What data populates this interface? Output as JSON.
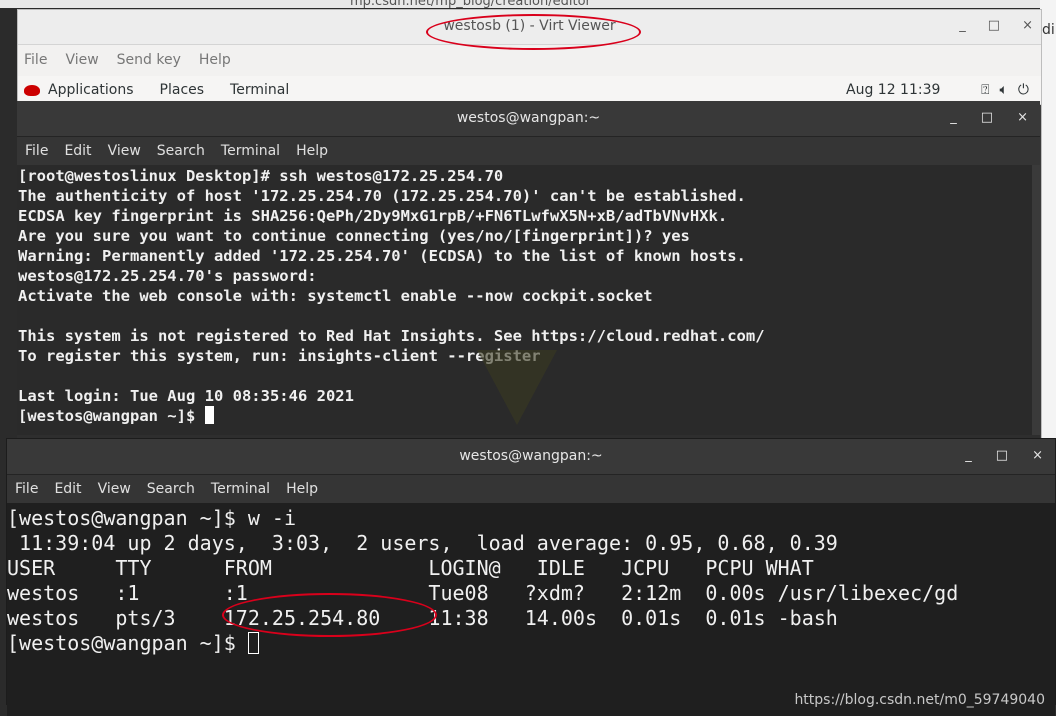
{
  "browser": {
    "url_fragment": "mp.csdn.net/mp_blog/creation/editor",
    "right_edge_text": "din"
  },
  "virt_viewer": {
    "title": "westosb (1) - Virt Viewer",
    "controls": [
      "_",
      "□",
      "×"
    ],
    "menu": [
      "File",
      "View",
      "Send key",
      "Help"
    ]
  },
  "gnome": {
    "applications": "Applications",
    "places": "Places",
    "terminal": "Terminal",
    "clock": "Aug 12  11:39",
    "icons": [
      "network-icon",
      "volume-icon",
      "power-icon"
    ]
  },
  "terminal1": {
    "title": "westos@wangpan:~",
    "controls": [
      "_",
      "□",
      "×"
    ],
    "menu": [
      "File",
      "Edit",
      "View",
      "Search",
      "Terminal",
      "Help"
    ],
    "lines": [
      "[root@westoslinux Desktop]# ssh westos@172.25.254.70",
      "The authenticity of host '172.25.254.70 (172.25.254.70)' can't be established.",
      "ECDSA key fingerprint is SHA256:QePh/2Dy9MxG1rpB/+FN6TLwfwX5N+xB/adTbVNvHXk.",
      "Are you sure you want to continue connecting (yes/no/[fingerprint])? yes",
      "Warning: Permanently added '172.25.254.70' (ECDSA) to the list of known hosts.",
      "westos@172.25.254.70's password:",
      "Activate the web console with: systemctl enable --now cockpit.socket",
      "",
      "This system is not registered to Red Hat Insights. See https://cloud.redhat.com/",
      "To register this system, run: insights-client --register",
      "",
      "Last login: Tue Aug 10 08:35:46 2021",
      "[westos@wangpan ~]$ "
    ]
  },
  "terminal2": {
    "title": "westos@wangpan:~",
    "controls": [
      "_",
      "□",
      "×"
    ],
    "menu": [
      "File",
      "Edit",
      "View",
      "Search",
      "Terminal",
      "Help"
    ],
    "lines": [
      "[westos@wangpan ~]$ w -i",
      " 11:39:04 up 2 days,  3:03,  2 users,  load average: 0.95, 0.68, 0.39",
      "USER     TTY      FROM             LOGIN@   IDLE   JCPU   PCPU WHAT",
      "westos   :1       :1               Tue08   ?xdm?   2:12m  0.00s /usr/libexec/gd",
      "westos   pts/3    172.25.254.80    11:38   14.00s  0.01s  0.01s -bash",
      "[westos@wangpan ~]$ "
    ]
  },
  "watermark": "https://blog.csdn.net/m0_59749040",
  "colors": {
    "annotation_red": "#d9001b",
    "terminal_bg": "#2a2a2a"
  }
}
